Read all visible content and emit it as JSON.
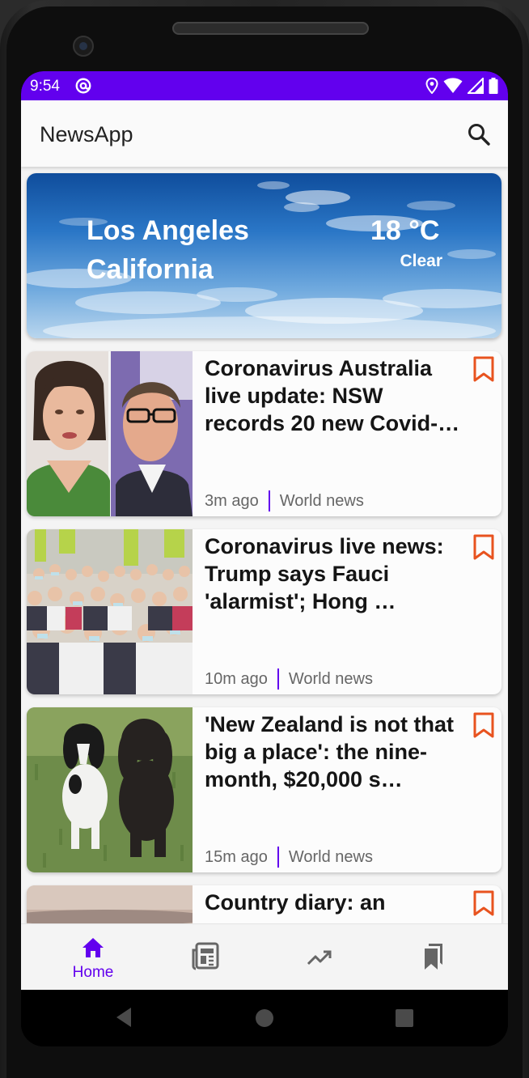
{
  "status_bar": {
    "time": "9:54",
    "color": "#6200ee",
    "icons": [
      "at-sign-icon",
      "location-icon",
      "wifi-icon",
      "signal-icon",
      "battery-icon"
    ]
  },
  "app_bar": {
    "title": "NewsApp",
    "search_icon": "search-icon"
  },
  "weather": {
    "city": "Los Angeles",
    "state": "California",
    "temperature": "18 °C",
    "condition": "Clear"
  },
  "articles": [
    {
      "title": "Coronavirus Australia live update: NSW records 20 new Covid-…",
      "time": "3m ago",
      "category": "World news",
      "bookmark_icon": "bookmark-outline-icon"
    },
    {
      "title": "Coronavirus live news: Trump says Fauci 'alarmist'; Hong …",
      "time": "10m ago",
      "category": "World news",
      "bookmark_icon": "bookmark-outline-icon"
    },
    {
      "title": "'New Zealand is not that big a place': the nine-month, $20,000 s…",
      "time": "15m ago",
      "category": "World news",
      "bookmark_icon": "bookmark-outline-icon"
    },
    {
      "title": "Country diary: an",
      "time": "",
      "category": "",
      "bookmark_icon": "bookmark-outline-icon"
    }
  ],
  "bottom_nav": {
    "items": [
      {
        "label": "Home",
        "icon": "home-icon",
        "active": true
      },
      {
        "label": "",
        "icon": "newspaper-icon",
        "active": false
      },
      {
        "label": "",
        "icon": "trending-icon",
        "active": false
      },
      {
        "label": "",
        "icon": "bookmarks-icon",
        "active": false
      }
    ],
    "active_color": "#6200ee"
  },
  "colors": {
    "accent": "#6200ee",
    "bookmark": "#e8531f"
  }
}
